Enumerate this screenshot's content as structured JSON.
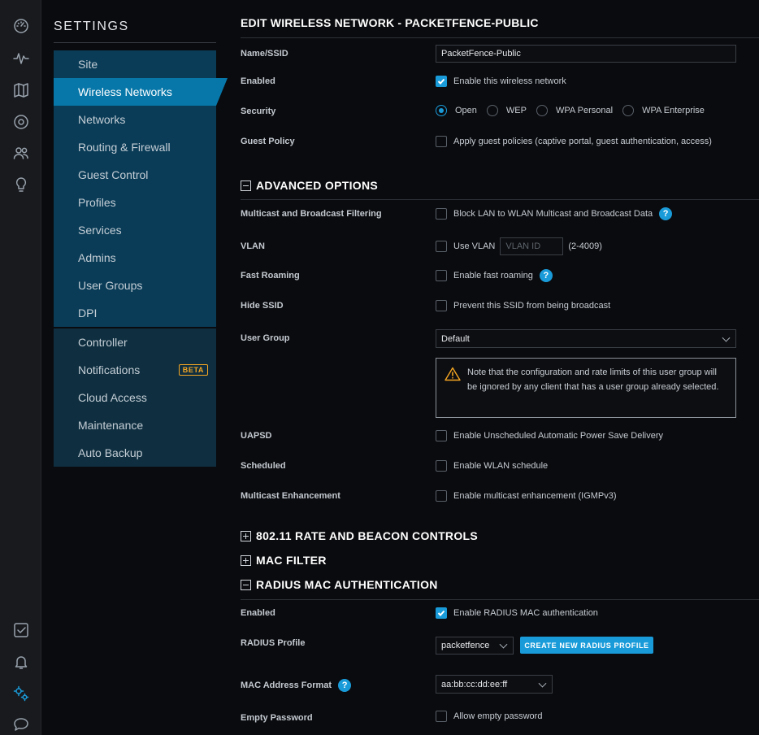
{
  "sidebar": {
    "title": "SETTINGS",
    "group1": [
      "Site",
      "Wireless Networks",
      "Networks",
      "Routing & Firewall",
      "Guest Control",
      "Profiles",
      "Services",
      "Admins",
      "User Groups",
      "DPI"
    ],
    "group2": [
      "Controller",
      "Notifications",
      "Cloud Access",
      "Maintenance",
      "Auto Backup"
    ],
    "notifications_badge": "BETA",
    "active": "Wireless Networks"
  },
  "rail_icons": [
    "dashboard-icon",
    "statistics-icon",
    "map-icon",
    "devices-icon",
    "clients-icon",
    "insights-icon",
    "alerts-icon",
    "events-icon",
    "settings-icon",
    "chat-icon"
  ],
  "page_title": "EDIT WIRELESS NETWORK - PACKETFENCE-PUBLIC",
  "basic": {
    "name_label": "Name/SSID",
    "name_value": "PacketFence-Public",
    "enabled_label": "Enabled",
    "enabled_text": "Enable this wireless network",
    "enabled_checked": true,
    "security_label": "Security",
    "security_options": [
      "Open",
      "WEP",
      "WPA Personal",
      "WPA Enterprise"
    ],
    "security_selected": "Open",
    "guest_label": "Guest Policy",
    "guest_text": "Apply guest policies (captive portal, guest authentication, access)"
  },
  "advanced": {
    "header": "ADVANCED OPTIONS",
    "multicast_label": "Multicast and Broadcast Filtering",
    "multicast_text": "Block LAN to WLAN Multicast and Broadcast Data",
    "vlan_label": "VLAN",
    "vlan_text": "Use VLAN",
    "vlan_placeholder": "VLAN ID",
    "vlan_range": "(2-4009)",
    "roaming_label": "Fast Roaming",
    "roaming_text": "Enable fast roaming",
    "hide_label": "Hide SSID",
    "hide_text": "Prevent this SSID from being broadcast",
    "usergroup_label": "User Group",
    "usergroup_value": "Default",
    "note": "Note that the configuration and rate limits of this user group will be ignored by any client that has a user group already selected.",
    "uapsd_label": "UAPSD",
    "uapsd_text": "Enable Unscheduled Automatic Power Save Delivery",
    "scheduled_label": "Scheduled",
    "scheduled_text": "Enable WLAN schedule",
    "mcast_enh_label": "Multicast Enhancement",
    "mcast_enh_text": "Enable multicast enhancement (IGMPv3)"
  },
  "sections": {
    "rate_beacon": "802.11 RATE AND BEACON CONTROLS",
    "mac_filter": "MAC FILTER",
    "radius_mac": "RADIUS MAC AUTHENTICATION"
  },
  "radius": {
    "enabled_label": "Enabled",
    "enabled_text": "Enable RADIUS MAC authentication",
    "enabled_checked": true,
    "profile_label": "RADIUS Profile",
    "profile_value": "packetfence",
    "create_button": "CREATE NEW RADIUS PROFILE",
    "mac_format_label": "MAC Address Format",
    "mac_format_value": "aa:bb:cc:dd:ee:ff",
    "empty_pw_label": "Empty Password",
    "empty_pw_text": "Allow empty password"
  },
  "colors": {
    "accent": "#1a9bd9",
    "sidebar_active": "#0777a9",
    "warning": "#f5a623"
  }
}
